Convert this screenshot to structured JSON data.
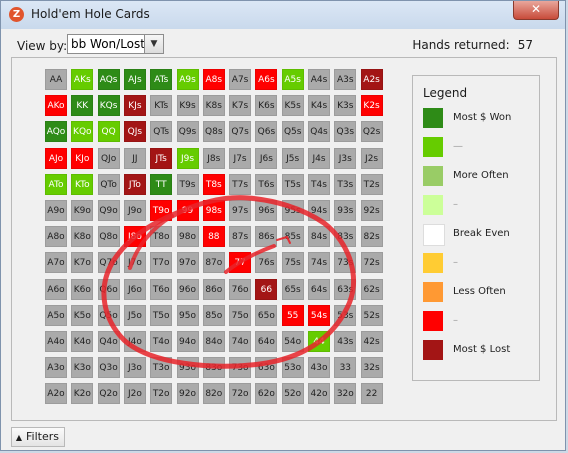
{
  "window": {
    "title": "Hold'em Hole Cards",
    "icon_text": "Z",
    "close_glyph": "✕"
  },
  "toolbar": {
    "view_by_label": "View by:",
    "view_by_value": "bb Won/Lost",
    "hands_label": "Hands returned:",
    "hands_value": "57"
  },
  "colors": {
    "most_won": "#2e8b17",
    "won2": "#66cc00",
    "more_often": "#99cc66",
    "light_green": "#ccff99",
    "break_even": "#ffffff",
    "orange_light": "#ffcc33",
    "less_often": "#ff9933",
    "red": "#ff0000",
    "most_lost": "#a31515",
    "gray": "#aaaaaa",
    "annotation": "#e8242a"
  },
  "grid": {
    "rows": [
      [
        "AA",
        "AKs",
        "AQs",
        "AJs",
        "ATs",
        "A9s",
        "A8s",
        "A7s",
        "A6s",
        "A5s",
        "A4s",
        "A3s",
        "A2s"
      ],
      [
        "AKo",
        "KK",
        "KQs",
        "KJs",
        "KTs",
        "K9s",
        "K8s",
        "K7s",
        "K6s",
        "K5s",
        "K4s",
        "K3s",
        "K2s"
      ],
      [
        "AQo",
        "KQo",
        "QQ",
        "QJs",
        "QTs",
        "Q9s",
        "Q8s",
        "Q7s",
        "Q6s",
        "Q5s",
        "Q4s",
        "Q3s",
        "Q2s"
      ],
      [
        "AJo",
        "KJo",
        "QJo",
        "JJ",
        "JTs",
        "J9s",
        "J8s",
        "J7s",
        "J6s",
        "J5s",
        "J4s",
        "J3s",
        "J2s"
      ],
      [
        "ATo",
        "KTo",
        "QTo",
        "JTo",
        "TT",
        "T9s",
        "T8s",
        "T7s",
        "T6s",
        "T5s",
        "T4s",
        "T3s",
        "T2s"
      ],
      [
        "A9o",
        "K9o",
        "Q9o",
        "J9o",
        "T9o",
        "99",
        "98s",
        "97s",
        "96s",
        "95s",
        "94s",
        "93s",
        "92s"
      ],
      [
        "A8o",
        "K8o",
        "Q8o",
        "J8o",
        "T8o",
        "98o",
        "88",
        "87s",
        "86s",
        "85s",
        "84s",
        "83s",
        "82s"
      ],
      [
        "A7o",
        "K7o",
        "Q7o",
        "J7o",
        "T7o",
        "97o",
        "87o",
        "77",
        "76s",
        "75s",
        "74s",
        "73s",
        "72s"
      ],
      [
        "A6o",
        "K6o",
        "Q6o",
        "J6o",
        "T6o",
        "96o",
        "86o",
        "76o",
        "66",
        "65s",
        "64s",
        "63s",
        "62s"
      ],
      [
        "A5o",
        "K5o",
        "Q5o",
        "J5o",
        "T5o",
        "95o",
        "85o",
        "75o",
        "65o",
        "55",
        "54s",
        "53s",
        "52s"
      ],
      [
        "A4o",
        "K4o",
        "Q4o",
        "J4o",
        "T4o",
        "94o",
        "84o",
        "74o",
        "64o",
        "54o",
        "44",
        "43s",
        "42s"
      ],
      [
        "A3o",
        "K3o",
        "Q3o",
        "J3o",
        "T3o",
        "93o",
        "83o",
        "73o",
        "63o",
        "53o",
        "43o",
        "33",
        "32s"
      ],
      [
        "A2o",
        "K2o",
        "Q2o",
        "J2o",
        "T2o",
        "92o",
        "82o",
        "72o",
        "62o",
        "52o",
        "42o",
        "32o",
        "22"
      ]
    ],
    "cell_colors": [
      [
        "gray",
        "won2",
        "most_won",
        "most_won",
        "most_won",
        "won2",
        "red",
        "gray",
        "red",
        "won2",
        "gray",
        "gray",
        "most_lost"
      ],
      [
        "red",
        "most_won",
        "most_won",
        "most_lost",
        "gray",
        "gray",
        "gray",
        "gray",
        "gray",
        "gray",
        "gray",
        "gray",
        "red"
      ],
      [
        "most_won",
        "won2",
        "won2",
        "most_lost",
        "gray",
        "gray",
        "gray",
        "gray",
        "gray",
        "gray",
        "gray",
        "gray",
        "gray"
      ],
      [
        "red",
        "red",
        "gray",
        "gray",
        "most_lost",
        "won2",
        "gray",
        "gray",
        "gray",
        "gray",
        "gray",
        "gray",
        "gray"
      ],
      [
        "won2",
        "won2",
        "gray",
        "most_lost",
        "most_won",
        "gray",
        "red",
        "gray",
        "gray",
        "gray",
        "gray",
        "gray",
        "gray"
      ],
      [
        "gray",
        "gray",
        "gray",
        "gray",
        "red",
        "red",
        "red",
        "gray",
        "gray",
        "gray",
        "gray",
        "gray",
        "gray"
      ],
      [
        "gray",
        "gray",
        "gray",
        "red",
        "gray",
        "gray",
        "red",
        "gray",
        "gray",
        "gray",
        "gray",
        "gray",
        "gray"
      ],
      [
        "gray",
        "gray",
        "gray",
        "gray",
        "gray",
        "gray",
        "gray",
        "red",
        "gray",
        "gray",
        "gray",
        "gray",
        "gray"
      ],
      [
        "gray",
        "gray",
        "gray",
        "gray",
        "gray",
        "gray",
        "gray",
        "gray",
        "most_lost",
        "gray",
        "gray",
        "gray",
        "gray"
      ],
      [
        "gray",
        "gray",
        "gray",
        "gray",
        "gray",
        "gray",
        "gray",
        "gray",
        "gray",
        "red",
        "red",
        "gray",
        "gray"
      ],
      [
        "gray",
        "gray",
        "gray",
        "gray",
        "gray",
        "gray",
        "gray",
        "gray",
        "gray",
        "gray",
        "won2",
        "gray",
        "gray"
      ],
      [
        "gray",
        "gray",
        "gray",
        "gray",
        "gray",
        "gray",
        "gray",
        "gray",
        "gray",
        "gray",
        "gray",
        "gray",
        "gray"
      ],
      [
        "gray",
        "gray",
        "gray",
        "gray",
        "gray",
        "gray",
        "gray",
        "gray",
        "gray",
        "gray",
        "gray",
        "gray",
        "gray"
      ]
    ]
  },
  "legend": {
    "title": "Legend",
    "items": [
      {
        "label": "Most $ Won",
        "color": "most_won"
      },
      {
        "label": "—",
        "color": "won2"
      },
      {
        "label": "More Often",
        "color": "more_often"
      },
      {
        "label": "–",
        "color": "light_green"
      },
      {
        "label": "Break Even",
        "color": "break_even"
      },
      {
        "label": "–",
        "color": "orange_light"
      },
      {
        "label": "Less Often",
        "color": "less_often"
      },
      {
        "label": "–",
        "color": "red"
      },
      {
        "label": "Most $ Lost",
        "color": "most_lost"
      }
    ]
  },
  "filters": {
    "label": "Filters",
    "arrow_glyph": "▲"
  }
}
